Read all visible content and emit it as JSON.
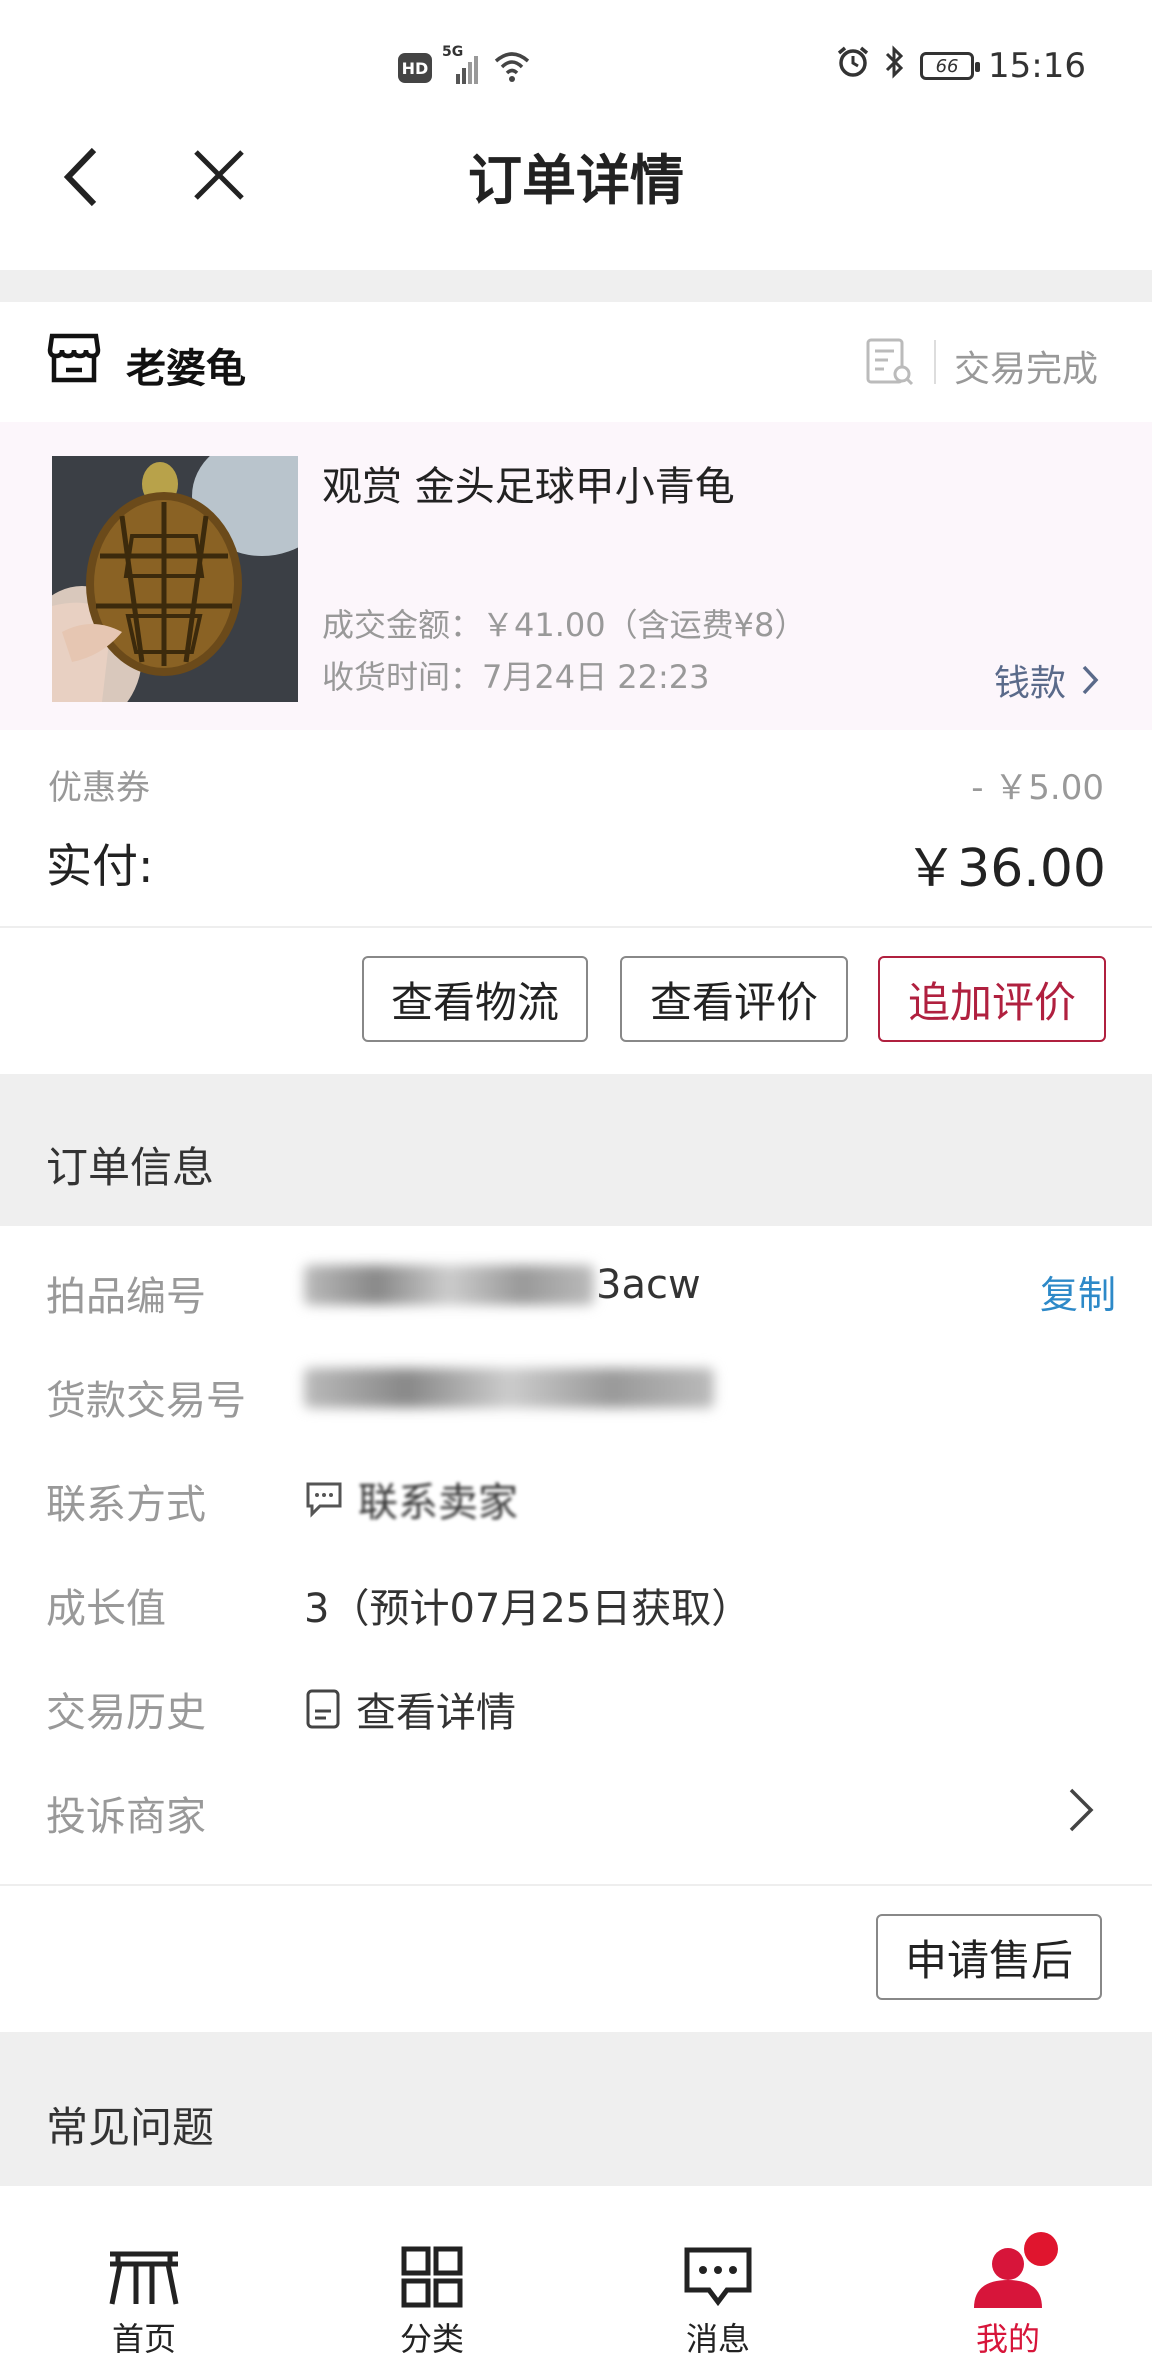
{
  "status_bar": {
    "network_badge": "HD",
    "network_type": "5G",
    "battery_level": "66",
    "time": "15:16"
  },
  "header": {
    "title": "订单详情"
  },
  "shop": {
    "name": "老婆龟",
    "order_status": "交易完成"
  },
  "product": {
    "title": "观赏 金头足球甲小青龟",
    "deal_amount": "成交金额：￥41.00（含运费¥8）",
    "receive_time": "收货时间：7月24日 22:23",
    "payment_link": "钱款"
  },
  "amounts": {
    "coupon_label": "优惠券",
    "coupon_value": "- ￥5.00",
    "paid_label": "实付:",
    "paid_value": "￥36.00"
  },
  "actions": {
    "logistics": "查看物流",
    "view_review": "查看评价",
    "add_review": "追加评价",
    "after_sale": "申请售后"
  },
  "order_info": {
    "section_title": "订单信息",
    "item_no_label": "拍品编号",
    "item_no_suffix": "3acw",
    "copy": "复制",
    "payment_no_label": "货款交易号",
    "contact_label": "联系方式",
    "contact_value": "联系卖家",
    "growth_label": "成长值",
    "growth_value": "3（预计07月25日获取）",
    "history_label": "交易历史",
    "history_value": "查看详情",
    "complaint_label": "投诉商家"
  },
  "faq": {
    "section_title": "常见问题"
  },
  "tabbar": {
    "home": "首页",
    "category": "分类",
    "messages": "消息",
    "mine": "我的",
    "active_color": "#d7153a"
  }
}
